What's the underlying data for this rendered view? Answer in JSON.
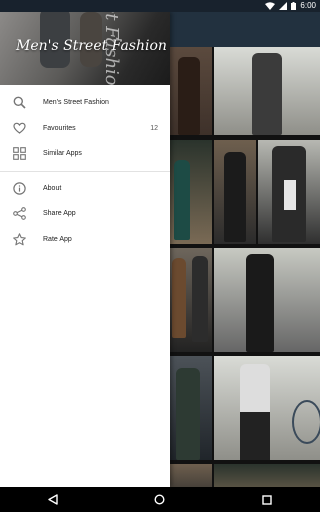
{
  "status_bar": {
    "time": "6:00",
    "icons": [
      "wifi-icon",
      "signal-icon",
      "battery-icon"
    ]
  },
  "drawer": {
    "header_title": "Men's Street Fashion",
    "header_side_text": "Street Fashion",
    "menu": [
      {
        "label": "Men's Street Fashion",
        "icon": "search-icon",
        "count": ""
      },
      {
        "label": "Favourites",
        "icon": "heart-icon",
        "count": "12"
      },
      {
        "label": "Similar Apps",
        "icon": "grid-icon",
        "count": ""
      }
    ],
    "secondary": [
      {
        "label": "About",
        "icon": "info-icon"
      },
      {
        "label": "Share App",
        "icon": "share-icon"
      },
      {
        "label": "Rate App",
        "icon": "star-icon"
      }
    ]
  },
  "nav_bar": {
    "buttons": [
      "back-icon",
      "home-icon",
      "recents-icon"
    ]
  },
  "colors": {
    "app_bar": "#22313f",
    "drawer_bg": "#ffffff",
    "status_bar": "#18222d"
  }
}
